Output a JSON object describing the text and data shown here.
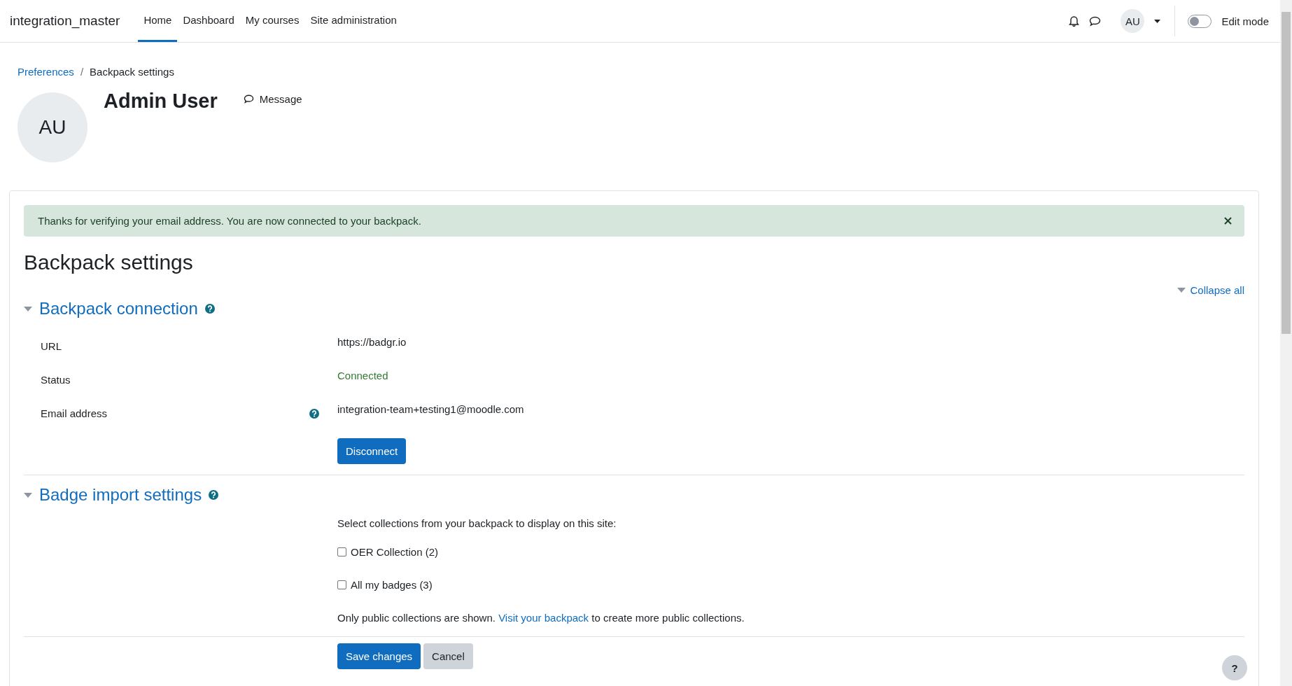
{
  "navbar": {
    "brand": "integration_master",
    "items": [
      {
        "label": "Home",
        "selected": true
      },
      {
        "label": "Dashboard",
        "selected": false
      },
      {
        "label": "My courses",
        "selected": false
      },
      {
        "label": "Site administration",
        "selected": false
      }
    ],
    "user_initials": "AU",
    "edit_mode": {
      "label": "Edit mode",
      "on": false
    }
  },
  "breadcrumb_separator": "/",
  "breadcrumb": [
    {
      "label": "Preferences",
      "kind": "link"
    },
    {
      "label": "Backpack settings",
      "kind": "current"
    }
  ],
  "profile": {
    "initials": "AU",
    "name": "Admin User",
    "message_label": "Message"
  },
  "alert": {
    "text": "Thanks for verifying your email address. You are now connected to your backpack."
  },
  "page_title": "Backpack settings",
  "collapse_all": "Collapse all",
  "sections": [
    {
      "title": "Backpack connection",
      "expanded": true,
      "kind": "fields",
      "rows": [
        {
          "kind": "text",
          "label": "URL",
          "value": "https://badgr.io",
          "help": false
        },
        {
          "kind": "status",
          "label": "Status",
          "value": "Connected",
          "help": false
        },
        {
          "kind": "text",
          "label": "Email address",
          "value": "integration-team+testing1@moodle.com",
          "help": true
        },
        {
          "kind": "button",
          "value": "Disconnect"
        }
      ]
    },
    {
      "title": "Badge import settings",
      "expanded": true,
      "kind": "collections",
      "intro": "Select collections from your backpack to display on this site:",
      "collections": [
        {
          "label": "OER Collection (2)",
          "checked": false
        },
        {
          "label": "All my badges (3)",
          "checked": false
        }
      ],
      "note_before": "Only public collections are shown. ",
      "note_link": "Visit your backpack",
      "note_after": " to create more public collections."
    }
  ],
  "buttons": [
    {
      "label": "Save changes",
      "kind": "primary"
    },
    {
      "label": "Cancel",
      "kind": "secondary"
    }
  ],
  "help_button": "?"
}
